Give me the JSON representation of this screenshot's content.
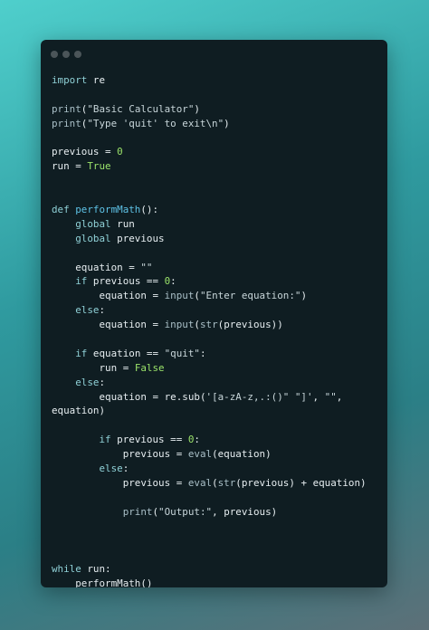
{
  "window": {
    "traffic_lights": [
      "close",
      "minimize",
      "maximize"
    ]
  },
  "colors": {
    "background_gradient": [
      "#4fcfcc",
      "#2f9a9f",
      "#2b7f86",
      "#5d7078"
    ],
    "editor_bg": "#0f1d22",
    "keyword": "#8fd0d6",
    "function_name": "#5ec2e6",
    "builtin": "#a9bfc7",
    "string": "#c7d5d9",
    "number_bool": "#9be36a",
    "text": "#e6edf0"
  },
  "code_lines": [
    [
      [
        "kw",
        "import"
      ],
      [
        "id",
        " re"
      ]
    ],
    [],
    [
      [
        "bi",
        "print"
      ],
      [
        "op",
        "("
      ],
      [
        "str",
        "\"Basic Calculator\""
      ],
      [
        "op",
        ")"
      ]
    ],
    [
      [
        "bi",
        "print"
      ],
      [
        "op",
        "("
      ],
      [
        "str",
        "\"Type 'quit' to exit\\n\""
      ],
      [
        "op",
        ")"
      ]
    ],
    [],
    [
      [
        "id",
        "previous"
      ],
      [
        "op",
        " = "
      ],
      [
        "num",
        "0"
      ]
    ],
    [
      [
        "id",
        "run"
      ],
      [
        "op",
        " = "
      ],
      [
        "bool",
        "True"
      ]
    ],
    [],
    [],
    [
      [
        "kw",
        "def"
      ],
      [
        "op",
        " "
      ],
      [
        "fn",
        "performMath"
      ],
      [
        "op",
        "():"
      ]
    ],
    [
      [
        "op",
        "    "
      ],
      [
        "kw",
        "global"
      ],
      [
        "id",
        " run"
      ]
    ],
    [
      [
        "op",
        "    "
      ],
      [
        "kw",
        "global"
      ],
      [
        "id",
        " previous"
      ]
    ],
    [],
    [
      [
        "op",
        "    "
      ],
      [
        "id",
        "equation"
      ],
      [
        "op",
        " = "
      ],
      [
        "str",
        "\"\""
      ]
    ],
    [
      [
        "op",
        "    "
      ],
      [
        "kw",
        "if"
      ],
      [
        "id",
        " previous"
      ],
      [
        "op",
        " == "
      ],
      [
        "num",
        "0"
      ],
      [
        "op",
        ":"
      ]
    ],
    [
      [
        "op",
        "        "
      ],
      [
        "id",
        "equation"
      ],
      [
        "op",
        " = "
      ],
      [
        "bi",
        "input"
      ],
      [
        "op",
        "("
      ],
      [
        "str",
        "\"Enter equation:\""
      ],
      [
        "op",
        ")"
      ]
    ],
    [
      [
        "op",
        "    "
      ],
      [
        "kw",
        "else"
      ],
      [
        "op",
        ":"
      ]
    ],
    [
      [
        "op",
        "        "
      ],
      [
        "id",
        "equation"
      ],
      [
        "op",
        " = "
      ],
      [
        "bi",
        "input"
      ],
      [
        "op",
        "("
      ],
      [
        "bi",
        "str"
      ],
      [
        "op",
        "("
      ],
      [
        "id",
        "previous"
      ],
      [
        "op",
        "))"
      ]
    ],
    [],
    [
      [
        "op",
        "    "
      ],
      [
        "kw",
        "if"
      ],
      [
        "id",
        " equation"
      ],
      [
        "op",
        " == "
      ],
      [
        "str",
        "\"quit\""
      ],
      [
        "op",
        ":"
      ]
    ],
    [
      [
        "op",
        "        "
      ],
      [
        "id",
        "run"
      ],
      [
        "op",
        " = "
      ],
      [
        "bool",
        "False"
      ]
    ],
    [
      [
        "op",
        "    "
      ],
      [
        "kw",
        "else"
      ],
      [
        "op",
        ":"
      ]
    ],
    [
      [
        "op",
        "        "
      ],
      [
        "id",
        "equation"
      ],
      [
        "op",
        " = "
      ],
      [
        "id",
        "re.sub"
      ],
      [
        "op",
        "("
      ],
      [
        "str",
        "'[a-zA-z,.:()\" \"]'"
      ],
      [
        "op",
        ", "
      ],
      [
        "str",
        "\"\""
      ],
      [
        "op",
        ","
      ]
    ],
    [
      [
        "id",
        "equation"
      ],
      [
        "op",
        ")"
      ]
    ],
    [],
    [
      [
        "op",
        "        "
      ],
      [
        "kw",
        "if"
      ],
      [
        "id",
        " previous"
      ],
      [
        "op",
        " == "
      ],
      [
        "num",
        "0"
      ],
      [
        "op",
        ":"
      ]
    ],
    [
      [
        "op",
        "            "
      ],
      [
        "id",
        "previous"
      ],
      [
        "op",
        " = "
      ],
      [
        "bi",
        "eval"
      ],
      [
        "op",
        "("
      ],
      [
        "id",
        "equation"
      ],
      [
        "op",
        ")"
      ]
    ],
    [
      [
        "op",
        "        "
      ],
      [
        "kw",
        "else"
      ],
      [
        "op",
        ":"
      ]
    ],
    [
      [
        "op",
        "            "
      ],
      [
        "id",
        "previous"
      ],
      [
        "op",
        " = "
      ],
      [
        "bi",
        "eval"
      ],
      [
        "op",
        "("
      ],
      [
        "bi",
        "str"
      ],
      [
        "op",
        "("
      ],
      [
        "id",
        "previous"
      ],
      [
        "op",
        ") + "
      ],
      [
        "id",
        "equation"
      ],
      [
        "op",
        ")"
      ]
    ],
    [],
    [
      [
        "op",
        "            "
      ],
      [
        "bi",
        "print"
      ],
      [
        "op",
        "("
      ],
      [
        "str",
        "\"Output:\""
      ],
      [
        "op",
        ", "
      ],
      [
        "id",
        "previous"
      ],
      [
        "op",
        ")"
      ]
    ],
    [],
    [],
    [],
    [
      [
        "kw",
        "while"
      ],
      [
        "id",
        " run"
      ],
      [
        "op",
        ":"
      ]
    ],
    [
      [
        "op",
        "    "
      ],
      [
        "id",
        "performMath"
      ],
      [
        "op",
        "()"
      ]
    ]
  ]
}
